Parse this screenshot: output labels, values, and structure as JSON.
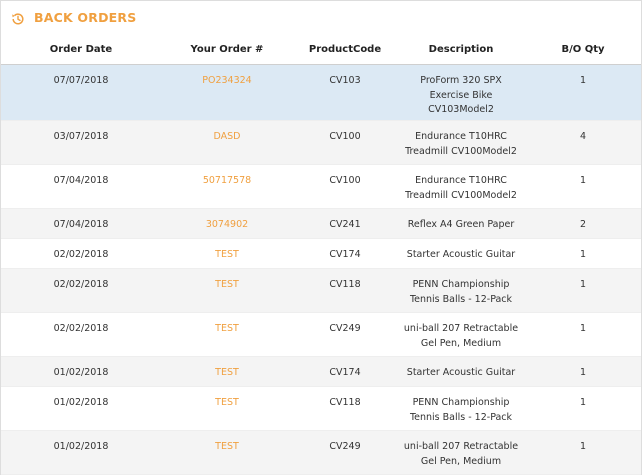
{
  "panel": {
    "title": "BACK ORDERS",
    "icon": "history-icon",
    "accent_color": "#f0a040"
  },
  "table": {
    "columns": [
      "Order Date",
      "Your Order #",
      "ProductCode",
      "Description",
      "B/O Qty"
    ],
    "rows": [
      {
        "date": "07/07/2018",
        "order": "PO234324",
        "code": "CV103",
        "desc": [
          "ProForm 320 SPX",
          "Exercise Bike",
          "CV103Model2"
        ],
        "qty": "1"
      },
      {
        "date": "03/07/2018",
        "order": "DASD",
        "code": "CV100",
        "desc": [
          "Endurance T10HRC",
          "Treadmill CV100Model2"
        ],
        "qty": "4"
      },
      {
        "date": "07/04/2018",
        "order": "50717578",
        "code": "CV100",
        "desc": [
          "Endurance T10HRC",
          "Treadmill CV100Model2"
        ],
        "qty": "1"
      },
      {
        "date": "07/04/2018",
        "order": "3074902",
        "code": "CV241",
        "desc": [
          "Reflex A4 Green Paper"
        ],
        "qty": "2"
      },
      {
        "date": "02/02/2018",
        "order": "TEST",
        "code": "CV174",
        "desc": [
          "Starter Acoustic Guitar"
        ],
        "qty": "1"
      },
      {
        "date": "02/02/2018",
        "order": "TEST",
        "code": "CV118",
        "desc": [
          "PENN Championship",
          "Tennis Balls - 12-Pack"
        ],
        "qty": "1"
      },
      {
        "date": "02/02/2018",
        "order": "TEST",
        "code": "CV249",
        "desc": [
          "uni-ball 207 Retractable",
          "Gel Pen, Medium"
        ],
        "qty": "1"
      },
      {
        "date": "01/02/2018",
        "order": "TEST",
        "code": "CV174",
        "desc": [
          "Starter Acoustic Guitar"
        ],
        "qty": "1"
      },
      {
        "date": "01/02/2018",
        "order": "TEST",
        "code": "CV118",
        "desc": [
          "PENN Championship",
          "Tennis Balls - 12-Pack"
        ],
        "qty": "1"
      },
      {
        "date": "01/02/2018",
        "order": "TEST",
        "code": "CV249",
        "desc": [
          "uni-ball 207 Retractable",
          "Gel Pen, Medium"
        ],
        "qty": "1"
      }
    ]
  }
}
